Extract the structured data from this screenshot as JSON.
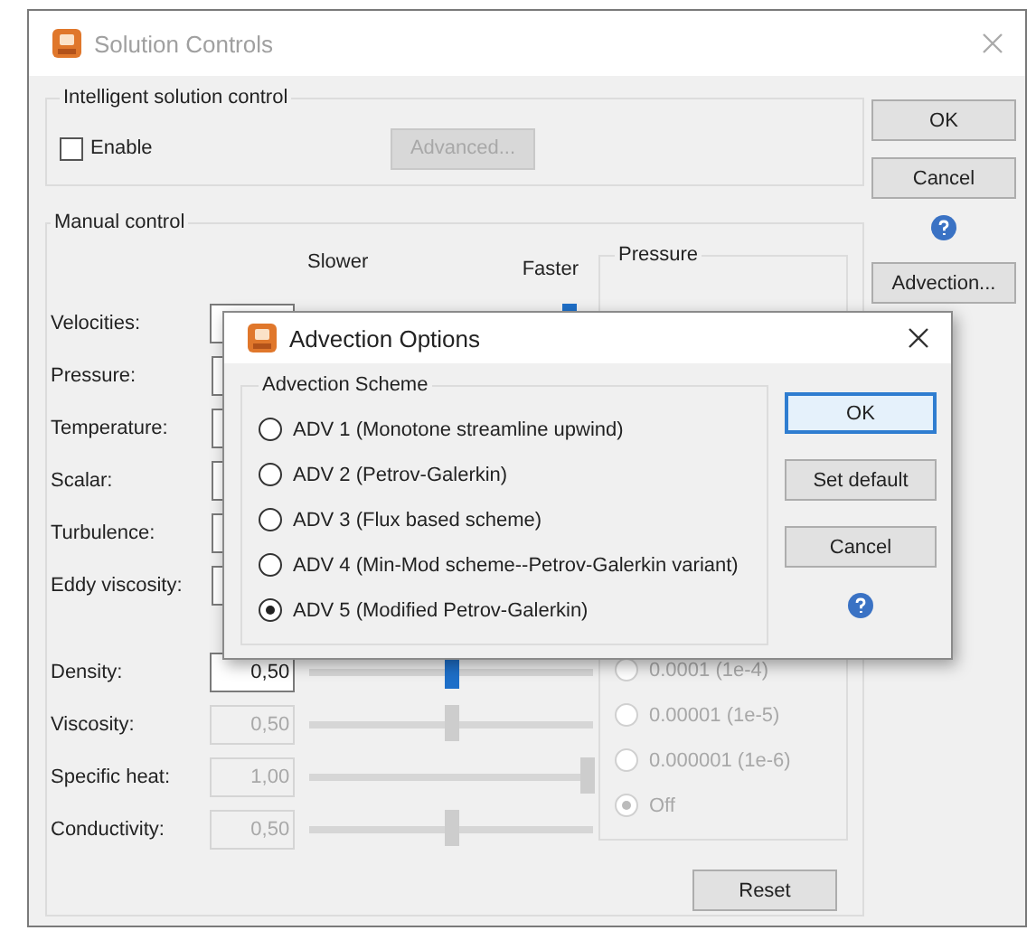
{
  "window": {
    "title": "Solution Controls"
  },
  "intelligent_control": {
    "label": "Intelligent solution control",
    "enable": {
      "label": "Enable",
      "checked": false
    },
    "advanced_button": {
      "label": "Advanced...",
      "disabled": true
    }
  },
  "manual_control": {
    "label": "Manual control",
    "slower_label": "Slower",
    "faster_label": "Faster",
    "rows": [
      {
        "label": "Velocities:",
        "level": 0.93,
        "disabled": false
      },
      {
        "label": "Pressure:"
      },
      {
        "label": "Temperature:"
      },
      {
        "label": "Scalar:"
      },
      {
        "label": "Turbulence:"
      },
      {
        "label": "Eddy viscosity:"
      },
      {
        "label": "Density:",
        "value": "0,50",
        "level": 0.5,
        "disabled": false
      },
      {
        "label": "Viscosity:",
        "value": "0,50",
        "level": 0.5,
        "disabled": true
      },
      {
        "label": "Specific heat:",
        "value": "1,00",
        "level": 1,
        "disabled": true
      },
      {
        "label": "Conductivity:",
        "value": "0,50",
        "level": 0.5,
        "disabled": true
      }
    ],
    "pressure": {
      "label": "Pressure",
      "disabled": true,
      "options": [
        {
          "label": "0.0001 (1e-4)",
          "selected": false
        },
        {
          "label": "0.00001 (1e-5)",
          "selected": false
        },
        {
          "label": "0.000001 (1e-6)",
          "selected": false
        },
        {
          "label": "Off",
          "selected": true
        }
      ]
    },
    "reset_button": "Reset"
  },
  "buttons": [
    {
      "kind": "button",
      "label": "OK"
    },
    {
      "kind": "button",
      "label": "Cancel"
    },
    {
      "kind": "help"
    },
    {
      "kind": "button",
      "label": "Advection..."
    }
  ],
  "advection_dialog": {
    "title": "Advection Options",
    "group_label": "Advection Scheme",
    "options": [
      {
        "label": "ADV 1  (Monotone streamline upwind)",
        "selected": false
      },
      {
        "label": "ADV 2 (Petrov-Galerkin)",
        "selected": false
      },
      {
        "label": "ADV 3 (Flux based scheme)",
        "selected": false
      },
      {
        "label": "ADV 4 (Min-Mod scheme--Petrov-Galerkin variant)",
        "selected": false
      },
      {
        "label": "ADV 5 (Modified Petrov-Galerkin)",
        "selected": true
      }
    ],
    "buttons": [
      {
        "label": "OK",
        "focused": true
      },
      {
        "label": "Set default",
        "focused": false
      },
      {
        "label": "Cancel",
        "focused": false
      }
    ]
  }
}
